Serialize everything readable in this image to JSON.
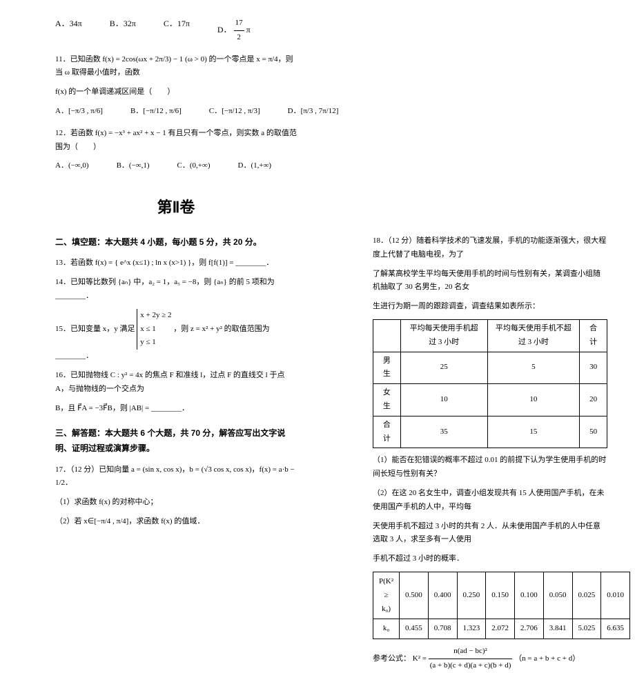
{
  "col1": {
    "q10_options": {
      "a": "A．34π",
      "b": "B．32π",
      "c": "C．17π",
      "d_num": "17",
      "d_den": "2",
      "d_prefix": "D．",
      "d_suffix": "π"
    },
    "q11": {
      "text": "11．已知函数 f(x) = 2cos(ωx + 2π/3) − 1 (ω > 0) 的一个零点是 x = π/4，则当 ω 取得最小值时，函数",
      "text2": "f(x) 的一个单调递减区间是（　　）",
      "opts": {
        "a": "A．[−π/3 , π/6]",
        "b": "B．[−π/12 , π/6]",
        "c": "C．[−π/12 , π/3]",
        "d": "D．[π/3 , 7π/12]"
      }
    },
    "q12": {
      "text": "12．若函数 f(x) = −x³ + ax² + x − 1 有且只有一个零点，则实数 a 的取值范围为（　　）",
      "opts": {
        "a": "A．(−∞,0)",
        "b": "B．(−∞,1)",
        "c": "C．(0,+∞)",
        "d": "D．(1,+∞)"
      }
    },
    "sec2_title": "第Ⅱ卷",
    "sec2_header": "二、填空题：本大题共 4 小题，每小题 5 分，共 20 分。",
    "q13": "13．若函数 f(x) = { e^x (x≤1) ; ln x (x>1) }，则 f[f(1)] = ________．",
    "q14": "14．已知等比数列 {aₙ} 中，a₂ = 1，a₅ = −8，则 {aₙ} 的前 5 项和为________．",
    "q15_prefix": "15．已知变量 x，y 满足",
    "q15_c1": "x + 2y ≥ 2",
    "q15_c2": "x ≤ 1",
    "q15_c3": "y ≤ 1",
    "q15_suffix": "，则 z = x² + y² 的取值范围为________．",
    "q16": "16．已知抛物线 C : y² = 4x 的焦点 F 和准线 l，过点 F 的直线交 l 于点 A，与抛物线的一个交点为",
    "q16b": "B，且 F⃗A = −3F⃗B，则 |AB| = ________．",
    "sec3_header": "三、解答题：本大题共 6 个大题，共 70 分，解答应写出文字说明、证明过程或演算步骤。",
    "q17": "17．（12 分）已知向量 a = (sin x, cos x)，b = (√3 cos x, cos x)，f(x) = a·b − 1/2．",
    "q17_1": "（1）求函数 f(x) 的对称中心；",
    "q17_2": "（2）若 x∈[−π/4 , π/4]，求函数 f(x) 的值域．"
  },
  "col2": {
    "q18_p1": "18．（12 分）随着科学技术的飞速发展，手机的功能逐渐强大，很大程度上代替了电脑电视，为了",
    "q18_p2": "了解某高校学生平均每天使用手机的时间与性别有关，某调查小组随机抽取了 30 名男生，20 名女",
    "q18_p3": "生进行为期一周的跟踪调查，调查结果如表所示：",
    "table1": {
      "h1": "平均每天使用手机超过 3 小时",
      "h2": "平均每天使用手机不超过 3 小时",
      "h3": "合计",
      "r1": [
        "男生",
        "25",
        "5",
        "30"
      ],
      "r2": [
        "女生",
        "10",
        "10",
        "20"
      ],
      "r3": [
        "合计",
        "35",
        "15",
        "50"
      ]
    },
    "q18_s1": "（1）能否在犯错误的概率不超过 0.01 的前提下认为学生使用手机的时间长短与性别有关？",
    "q18_s2": "（2）在这 20 名女生中，调查小组发现共有 15 人使用国产手机，在未使用国产手机的人中，平均每",
    "q18_s3": "天使用手机不超过 3 小时的共有 2 人．从未使用国产手机的人中任意选取 3 人，求至多有一人使用",
    "q18_s4": "手机不超过 3 小时的概率．",
    "table2": {
      "r1": [
        "P(K² ≥ k₀)",
        "0.500",
        "0.400",
        "0.250",
        "0.150",
        "0.100",
        "0.050",
        "0.025",
        "0.010"
      ],
      "r2": [
        "k₀",
        "0.455",
        "0.708",
        "1.323",
        "2.072",
        "2.706",
        "3.841",
        "5.025",
        "6.635"
      ]
    },
    "formula_label": "参考公式：",
    "formula_num": "n(ad − bc)²",
    "formula_den": "(a + b)(c + d)(a + c)(b + d)",
    "formula_prefix": "K² = ",
    "formula_suffix": "（n = a + b + c + d）"
  }
}
